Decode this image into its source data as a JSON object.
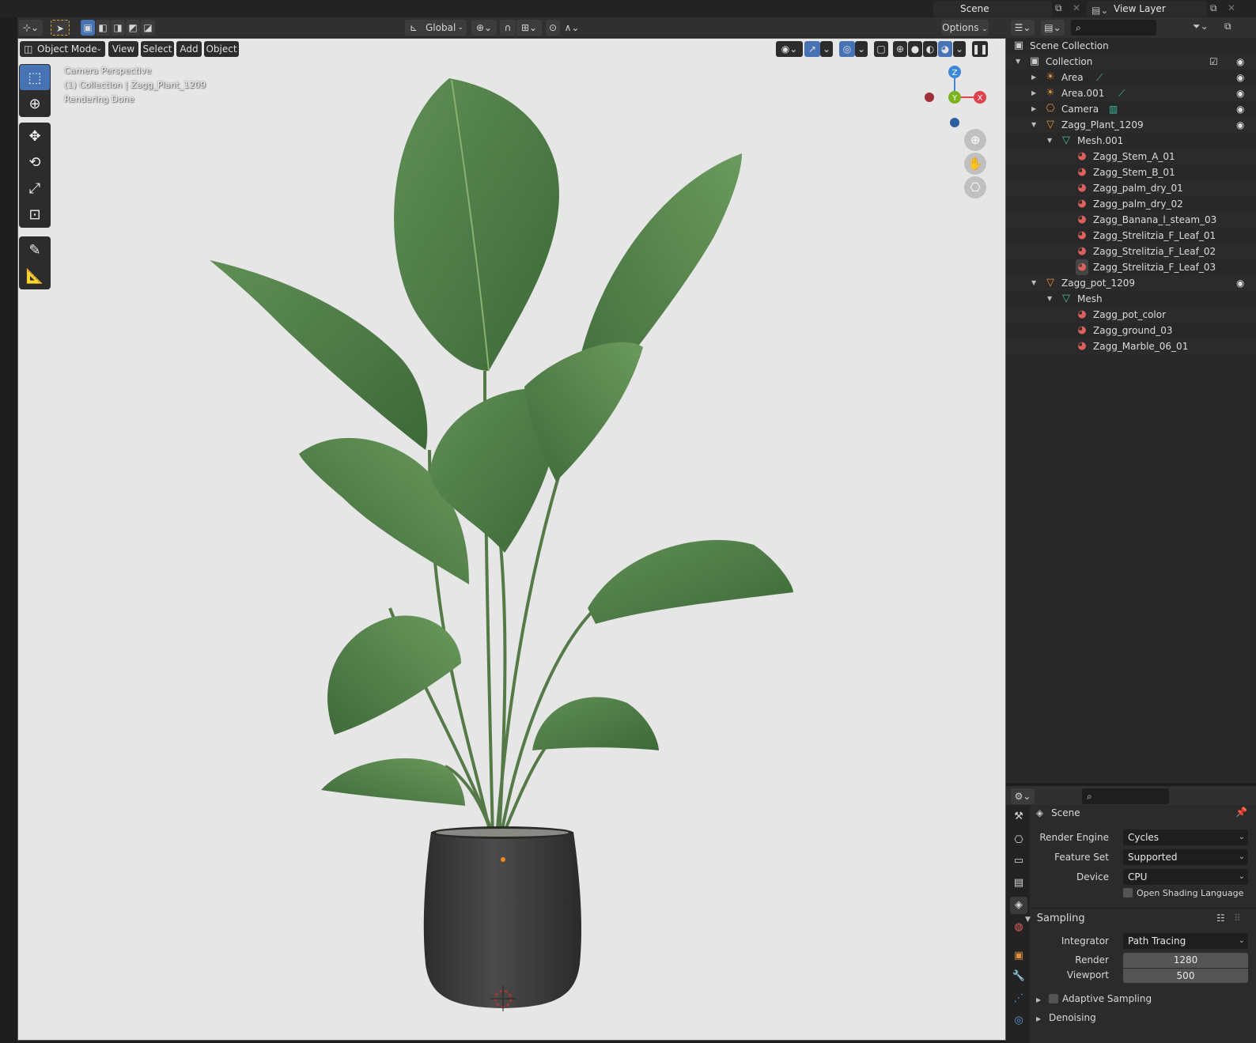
{
  "topbar": {
    "scene_label": "Scene",
    "view_layer_label": "View Layer"
  },
  "header": {
    "transform_orientation": "Global",
    "options_label": "Options"
  },
  "viewport_menu": {
    "mode": "Object Mode",
    "view": "View",
    "select": "Select",
    "add": "Add",
    "object": "Object"
  },
  "viewport_overlay": {
    "line1": "Camera Perspective",
    "line2": "(1) Collection | Zagg_Plant_1209",
    "line3": "Rendering Done"
  },
  "gizmo": {
    "z": "Z",
    "y": "Y",
    "x": "X"
  },
  "outliner": {
    "root": "Scene Collection",
    "collection": "Collection",
    "items": [
      {
        "label": "Area"
      },
      {
        "label": "Area.001"
      },
      {
        "label": "Camera"
      },
      {
        "label": "Zagg_Plant_1209"
      },
      {
        "label": "Mesh.001"
      },
      {
        "label": "Zagg_Stem_A_01"
      },
      {
        "label": "Zagg_Stem_B_01"
      },
      {
        "label": "Zagg_palm_dry_01"
      },
      {
        "label": "Zagg_palm_dry_02"
      },
      {
        "label": "Zagg_Banana_l_steam_03"
      },
      {
        "label": "Zagg_Strelitzia_F_Leaf_01"
      },
      {
        "label": "Zagg_Strelitzia_F_Leaf_02"
      },
      {
        "label": "Zagg_Strelitzia_F_Leaf_03"
      },
      {
        "label": "Zagg_pot_1209"
      },
      {
        "label": "Mesh"
      },
      {
        "label": "Zagg_pot_color"
      },
      {
        "label": "Zagg_ground_03"
      },
      {
        "label": "Zagg_Marble_06_01"
      }
    ]
  },
  "properties": {
    "context": "Scene",
    "render_engine_label": "Render Engine",
    "render_engine_value": "Cycles",
    "feature_set_label": "Feature Set",
    "feature_set_value": "Supported",
    "device_label": "Device",
    "device_value": "CPU",
    "osl_label": "Open Shading Language",
    "sampling_label": "Sampling",
    "integrator_label": "Integrator",
    "integrator_value": "Path Tracing",
    "render_label": "Render",
    "render_value": "1280",
    "viewport_label": "Viewport",
    "viewport_value": "500",
    "adaptive_label": "Adaptive Sampling",
    "denoising_label": "Denoising"
  },
  "colors": {
    "accent": "#4772b3",
    "viewport_bg": "#e6e6e6",
    "leaf_green": "#4d7a44",
    "pot": "#3a3b3a",
    "axis_x": "#e0424c",
    "axis_y": "#7ab41f",
    "axis_z": "#3e86d8"
  }
}
